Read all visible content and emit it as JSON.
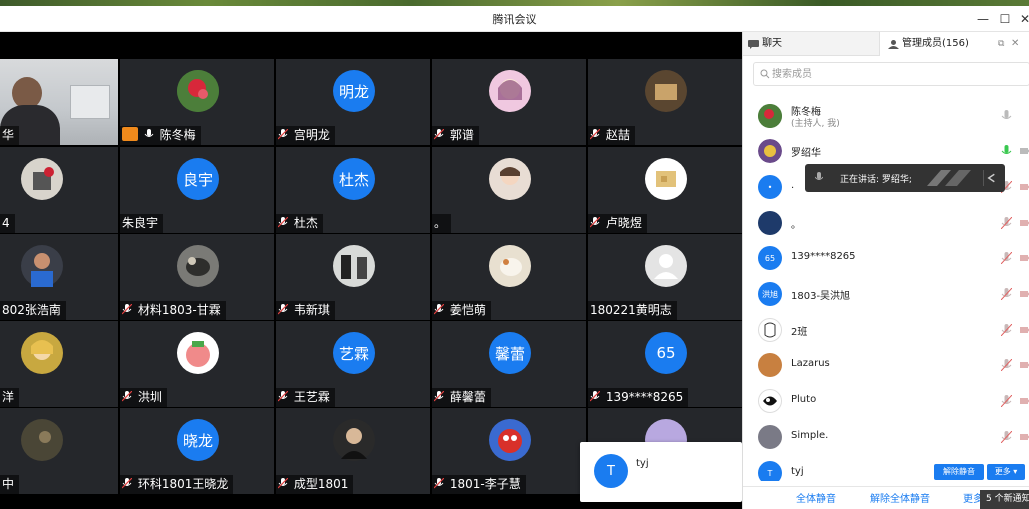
{
  "window": {
    "title": "腾讯会议",
    "minimize": "—",
    "maximize": "☐",
    "close": "✕"
  },
  "grid": {
    "tiles": [
      {
        "name": "华",
        "avatar_text": "",
        "mic": false,
        "host": false
      },
      {
        "name": "陈冬梅",
        "avatar_text": "",
        "mic": true,
        "host": true
      },
      {
        "name": "宫明龙",
        "avatar_text": "明龙",
        "mic": true,
        "host": false
      },
      {
        "name": "郭谱",
        "avatar_text": "",
        "mic": true,
        "host": false
      },
      {
        "name": "赵喆",
        "avatar_text": "",
        "mic": true,
        "host": false
      },
      {
        "name": "4",
        "avatar_text": "",
        "mic": false,
        "host": false
      },
      {
        "name": "朱良宇",
        "avatar_text": "良宇",
        "mic": false,
        "host": false
      },
      {
        "name": "杜杰",
        "avatar_text": "杜杰",
        "mic": true,
        "host": false
      },
      {
        "name": "。",
        "avatar_text": "",
        "mic": false,
        "host": false
      },
      {
        "name": "卢晓煜",
        "avatar_text": "",
        "mic": true,
        "host": false
      },
      {
        "name": "802张浩南",
        "avatar_text": "",
        "mic": false,
        "host": false
      },
      {
        "name": "材料1803-甘霖",
        "avatar_text": "",
        "mic": true,
        "host": false
      },
      {
        "name": "韦新琪",
        "avatar_text": "",
        "mic": true,
        "host": false
      },
      {
        "name": "姜恺萌",
        "avatar_text": "",
        "mic": true,
        "host": false
      },
      {
        "name": "180221黄明志",
        "avatar_text": "",
        "mic": false,
        "host": false
      },
      {
        "name": "洋",
        "avatar_text": "",
        "mic": false,
        "host": false
      },
      {
        "name": "洪圳",
        "avatar_text": "",
        "mic": true,
        "host": false
      },
      {
        "name": "王艺霖",
        "avatar_text": "艺霖",
        "mic": true,
        "host": false
      },
      {
        "name": "薛馨蕾",
        "avatar_text": "馨蕾",
        "mic": true,
        "host": false
      },
      {
        "name": "139****8265",
        "avatar_text": "65",
        "mic": true,
        "host": false
      },
      {
        "name": "中",
        "avatar_text": "",
        "mic": false,
        "host": false
      },
      {
        "name": "环科1801王晓龙",
        "avatar_text": "晓龙",
        "mic": true,
        "host": false
      },
      {
        "name": "成型1801",
        "avatar_text": "",
        "mic": true,
        "host": false
      },
      {
        "name": "1801-李子慧",
        "avatar_text": "",
        "mic": true,
        "host": false
      },
      {
        "name": "",
        "avatar_text": "",
        "mic": false,
        "host": false
      }
    ]
  },
  "popup": {
    "avatar_text": "T",
    "name": "tyj"
  },
  "panel": {
    "tab_chat": "聊天",
    "tab_members": "管理成员(156)",
    "search_placeholder": "搜索成员",
    "members": [
      {
        "name": "陈冬梅",
        "sub": "(主持人, 我)",
        "avatar_text": ""
      },
      {
        "name": "罗绍华",
        "sub": "",
        "avatar_text": ""
      },
      {
        "name": ".",
        "sub": "",
        "avatar_text": "•"
      },
      {
        "name": "。",
        "sub": "",
        "avatar_text": ""
      },
      {
        "name": "139****8265",
        "sub": "",
        "avatar_text": "65"
      },
      {
        "name": "1803-吴洪旭",
        "sub": "",
        "avatar_text": "洪旭"
      },
      {
        "name": "2班",
        "sub": "",
        "avatar_text": ""
      },
      {
        "name": "Lazarus",
        "sub": "",
        "avatar_text": ""
      },
      {
        "name": "Pluto",
        "sub": "",
        "avatar_text": ""
      },
      {
        "name": "Simple.",
        "sub": "",
        "avatar_text": ""
      },
      {
        "name": "tyj",
        "sub": "",
        "avatar_text": "T"
      }
    ],
    "tooltip": "正在讲话: 罗绍华;",
    "unmute_btn": "解除静音",
    "more_btn": "更多 ▾",
    "mute_all": "全体静音",
    "unmute_all": "解除全体静音",
    "more": "更多",
    "notice": "5 个新通知"
  }
}
